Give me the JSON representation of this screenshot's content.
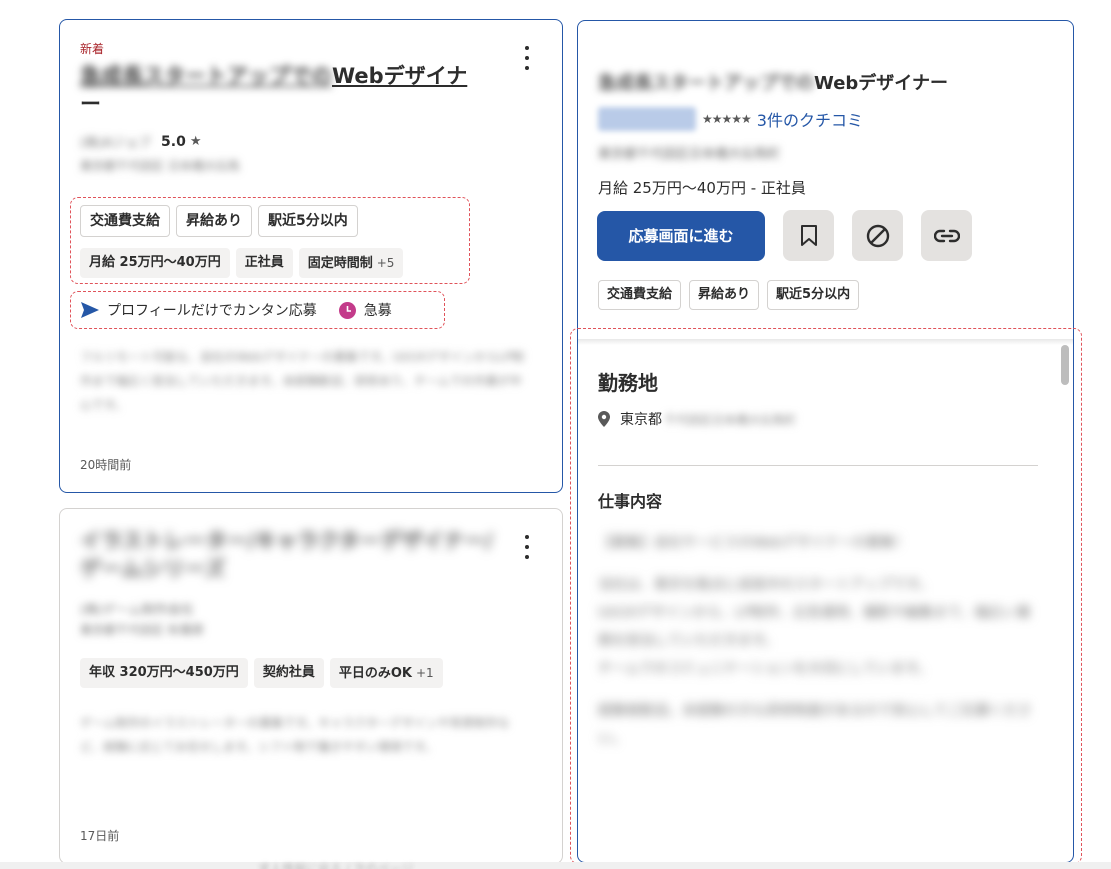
{
  "jobs": [
    {
      "new_label": "新着",
      "title_blurred": "急成長スタートアップでの",
      "title_visible": "Webデザイナ",
      "title_wrap": "ー",
      "company_blurred": "(株)Aジョブ",
      "rating": "5.0",
      "location_blurred": "東京都千代田区 日本橋大伝馬",
      "tags_outline": [
        "交通費支給",
        "昇給あり",
        "駅近5分以内"
      ],
      "tags_grey": [
        "月給 25万円～40万円",
        "正社員",
        "固定時間制"
      ],
      "tags_more": "+5",
      "apply_text": "プロフィールだけでカンタン応募",
      "urgent_text": "急募",
      "snippet_blurred": "フルリモート可能な、自社のWebデザイナーの募集です。UI/UXデザインからLP制作まで幅広く担当していただきます。未経験歓迎、研修あり、チームでの作業が中心です。",
      "posted": "20時間前"
    },
    {
      "title_blurred": "イラストレーター/キャラクターデザイナー/ゲームシリーズ",
      "company_blurred": "(株)ゲーム制作会社",
      "location_blurred": "東京都千代田区 秋葉原",
      "tags_grey": [
        "年収 320万円～450万円",
        "契約社員",
        "平日のみOK"
      ],
      "tags_more": "+1",
      "snippet_blurred": "ゲーム制作のイラストレーターの募集です。キャラクターデザインや背景制作など、経験に応じてお任せします。シフト制で働きやすい環境です。",
      "posted": "17日前"
    }
  ],
  "detail": {
    "title_blurred": "急成長スタートアップでの",
    "title_visible": "Webデザイナー",
    "stars": "★★★★★",
    "reviews_link": "3件のクチコミ",
    "address_blurred": "東京都千代田区日本橋大伝馬町",
    "salary": "月給 25万円～40万円  - 正社員",
    "apply_button": "応募画面に進む",
    "tags": [
      "交通費支給",
      "昇給あり",
      "駅近5分以内"
    ],
    "section_location": "勤務地",
    "location_prefecture": "東京都",
    "location_rest_blurred": "千代田区日本橋大伝馬町",
    "section_job": "仕事内容",
    "desc_blurred": [
      "【募集】自社サービスのWebデザイナーの募集！",
      "当社は、東京を拠点に成長中のスタートアップです。",
      "UI/UXデザインから、LP制作、広告運用、撮影や編集まで、幅広い業務を担当していただきます。",
      "チームでのコミュニケーションを大切にしています。",
      "経験者歓迎。未経験の方も研修制度があるので安心してご応募ください。"
    ]
  },
  "footer_blurred": "求人情報に戻る / 次のページ"
}
